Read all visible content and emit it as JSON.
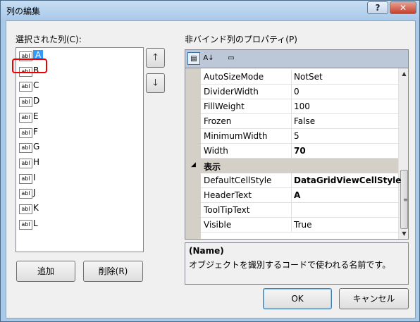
{
  "window": {
    "title": "列の編集",
    "help_label": "?",
    "close_label": "✕"
  },
  "columns": {
    "label": "選択された列(C):",
    "items": [
      "A",
      "B",
      "C",
      "D",
      "E",
      "F",
      "G",
      "H",
      "I",
      "J",
      "K",
      "L"
    ],
    "selected": "A",
    "highlighted": "B",
    "type_icon_label": "abl"
  },
  "move_up_icon": "arrow-up",
  "move_down_icon": "arrow-down",
  "buttons": {
    "add": "追加",
    "remove": "削除(R)",
    "ok": "OK",
    "cancel": "キャンセル"
  },
  "properties": {
    "label": "非バインド列のプロパティ(P)",
    "rows_top": [
      {
        "name": "AutoSizeMode",
        "value": "NotSet",
        "bold": false
      },
      {
        "name": "DividerWidth",
        "value": "0",
        "bold": false
      },
      {
        "name": "FillWeight",
        "value": "100",
        "bold": false
      },
      {
        "name": "Frozen",
        "value": "False",
        "bold": false
      },
      {
        "name": "MinimumWidth",
        "value": "5",
        "bold": false
      },
      {
        "name": "Width",
        "value": "70",
        "bold": true
      }
    ],
    "category": "表示",
    "rows_bottom": [
      {
        "name": "DefaultCellStyle",
        "value": "DataGridViewCellStyle",
        "bold": true
      },
      {
        "name": "HeaderText",
        "value": "A",
        "bold": true
      },
      {
        "name": "ToolTipText",
        "value": "",
        "bold": false
      },
      {
        "name": "Visible",
        "value": "True",
        "bold": false
      }
    ]
  },
  "description": {
    "name": "(Name)",
    "text": "オブジェクトを識別するコードで使われる名前です。"
  }
}
